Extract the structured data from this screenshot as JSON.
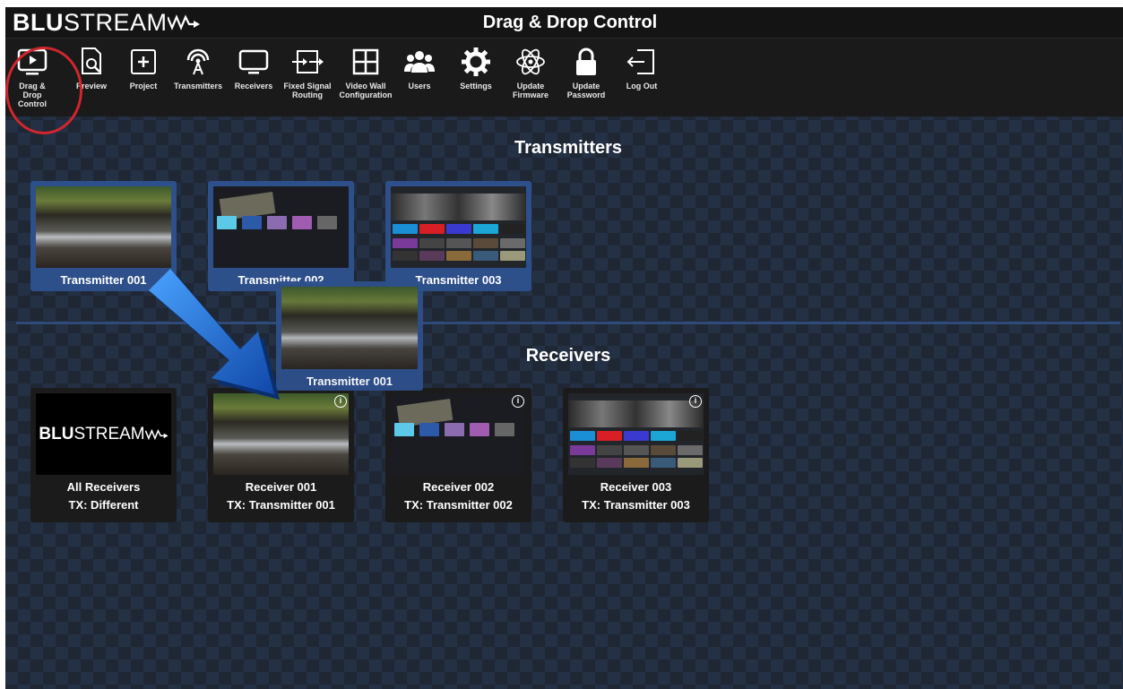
{
  "header": {
    "logo_bold": "BLU",
    "logo_rest": "STREAM",
    "title": "Drag & Drop Control"
  },
  "toolbar": {
    "items": [
      {
        "label": "Drag & Drop\nControl",
        "icon": "play-screen-icon"
      },
      {
        "label": "Preview",
        "icon": "document-search-icon"
      },
      {
        "label": "Project",
        "icon": "plus-box-icon"
      },
      {
        "label": "Transmitters",
        "icon": "antenna-icon"
      },
      {
        "label": "Receivers",
        "icon": "monitor-icon"
      },
      {
        "label": "Fixed Signal\nRouting",
        "icon": "routing-icon"
      },
      {
        "label": "Video Wall\nConfiguration",
        "icon": "grid-icon"
      },
      {
        "label": "Users",
        "icon": "users-icon"
      },
      {
        "label": "Settings",
        "icon": "gear-icon"
      },
      {
        "label": "Update\nFirmware",
        "icon": "atom-icon"
      },
      {
        "label": "Update\nPassword",
        "icon": "lock-icon"
      },
      {
        "label": "Log Out",
        "icon": "logout-icon"
      }
    ]
  },
  "transmitters": {
    "title": "Transmitters",
    "items": [
      {
        "name": "Transmitter 001",
        "thumb": "waterfall"
      },
      {
        "name": "Transmitter 002",
        "thumb": "firetv"
      },
      {
        "name": "Transmitter 003",
        "thumb": "prime"
      }
    ]
  },
  "receivers": {
    "title": "Receivers",
    "items": [
      {
        "name": "All Receivers",
        "tx": "TX: Different",
        "thumb": "blustream"
      },
      {
        "name": "Receiver 001",
        "tx": "TX: Transmitter 001",
        "thumb": "waterfall"
      },
      {
        "name": "Receiver 002",
        "tx": "TX: Transmitter 002",
        "thumb": "firetv"
      },
      {
        "name": "Receiver 003",
        "tx": "TX: Transmitter 003",
        "thumb": "prime"
      }
    ]
  },
  "drag": {
    "name": "Transmitter 001"
  },
  "colors": {
    "accent": "#2d4f8a",
    "highlight": "#d0262d",
    "arrow": "#1f6fd6"
  }
}
